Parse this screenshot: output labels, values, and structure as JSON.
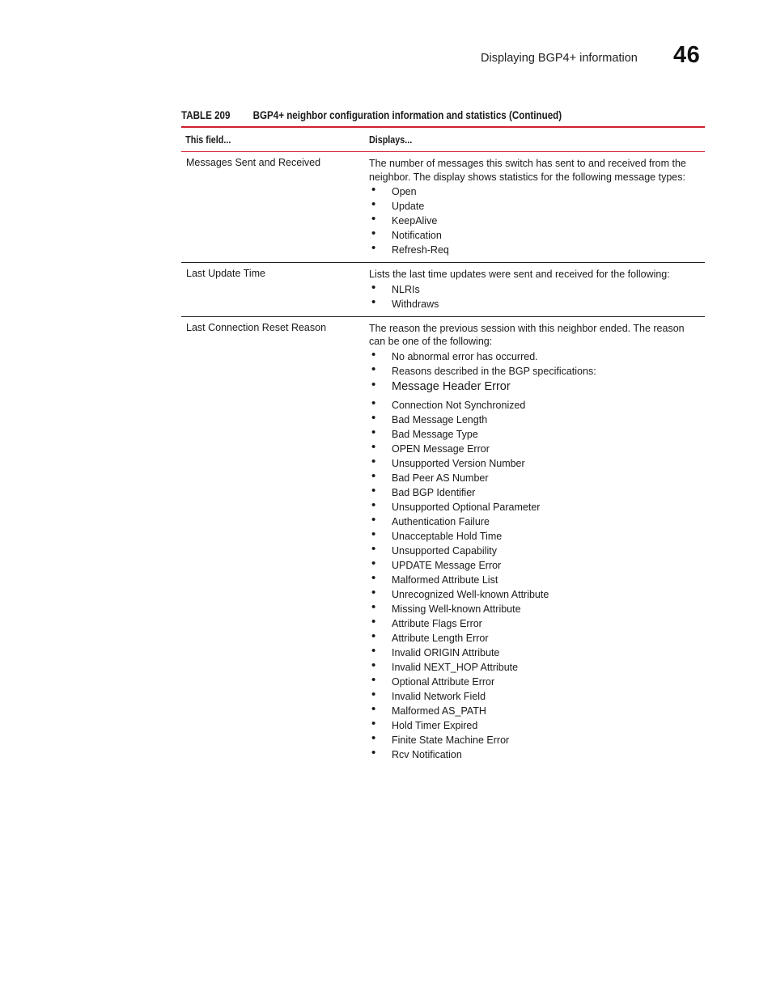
{
  "header": {
    "running_title": "Displaying BGP4+ information",
    "chapter_number": "46"
  },
  "table": {
    "label": "TABLE 209",
    "caption": "BGP4+ neighbor configuration information and statistics  (Continued)",
    "columns": [
      "This field...",
      "Displays..."
    ],
    "rows": [
      {
        "field": "Messages Sent and Received",
        "description": "The number of messages this switch has sent to and received from the neighbor. The display shows statistics for the following message types:",
        "bullets": [
          "Open",
          "Update",
          "KeepAlive",
          "Notification",
          "Refresh-Req"
        ]
      },
      {
        "field": "Last Update Time",
        "description": "Lists the last time updates were sent and received for the following:",
        "bullets": [
          "NLRIs",
          "Withdraws"
        ]
      },
      {
        "field": "Last Connection Reset Reason",
        "description": "The reason the previous session with this neighbor ended. The reason can be one of the following:",
        "bullets": [
          "No abnormal error has occurred.",
          "Reasons described in the BGP specifications:",
          "Message Header Error",
          "Connection Not Synchronized",
          "Bad Message Length",
          "Bad Message Type",
          "OPEN Message Error",
          "Unsupported Version Number",
          "Bad Peer AS Number",
          "Bad BGP Identifier",
          "Unsupported Optional Parameter",
          "Authentication Failure",
          "Unacceptable Hold Time",
          "Unsupported Capability",
          "UPDATE Message Error",
          "Malformed Attribute List",
          "Unrecognized Well-known Attribute",
          "Missing Well-known Attribute",
          "Attribute Flags Error",
          "Attribute Length Error",
          "Invalid ORIGIN Attribute",
          "Invalid NEXT_HOP Attribute",
          "Optional Attribute Error",
          "Invalid Network Field",
          "Malformed AS_PATH",
          "Hold Timer Expired",
          "Finite State Machine Error",
          "Rcv Notification"
        ]
      }
    ]
  },
  "colors": {
    "accent_red": "#d0202e"
  }
}
